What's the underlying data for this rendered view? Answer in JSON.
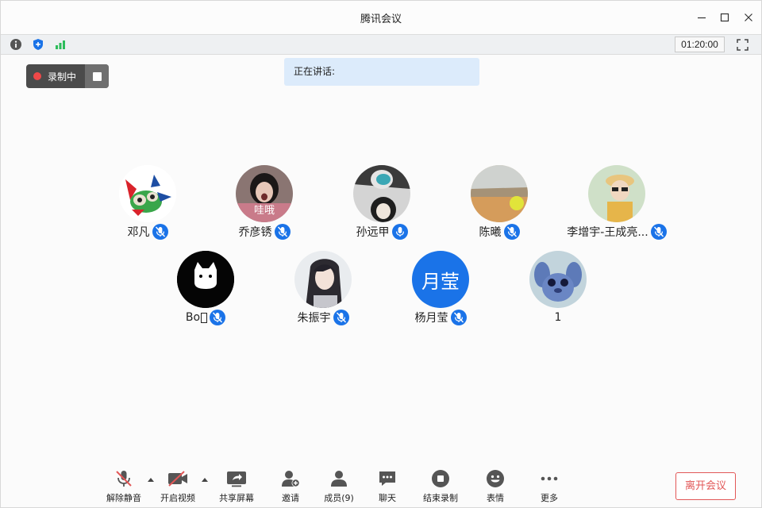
{
  "window": {
    "title": "腾讯会议"
  },
  "status": {
    "timer": "01:20:00",
    "info_icon": "info-icon",
    "security_icon": "shield-icon",
    "signal_icon": "signal-bars-icon"
  },
  "recording": {
    "label": "录制中"
  },
  "speaking": {
    "label": "正在讲话:"
  },
  "participants": [
    {
      "name": "邓凡",
      "avatar": "cartoon-character-avatar"
    },
    {
      "name": "乔彦锈",
      "avatar": "photo-avatar",
      "overlay": "哇哦"
    },
    {
      "name": "孙远甲",
      "avatar": "photo-avatar"
    },
    {
      "name": "陈曦",
      "avatar": "tennis-ball-photo-avatar"
    },
    {
      "name": "李增宇-王成亮...",
      "avatar": "photo-avatar"
    },
    {
      "name": "Bo",
      "avatar": "black-cat-logo-avatar"
    },
    {
      "name": "朱振宇",
      "avatar": "illustrated-portrait-avatar"
    },
    {
      "name": "杨月莹",
      "avatar": "text-avatar",
      "initials": "月莹"
    },
    {
      "name": "1",
      "avatar": "stitch-cartoon-avatar"
    }
  ],
  "toolbar": {
    "unmute": "解除静音",
    "video": "开启视频",
    "share": "共享屏幕",
    "invite": "邀请",
    "members": "成员(9)",
    "chat": "聊天",
    "end_record": "结束录制",
    "emoji": "表情",
    "more": "更多",
    "leave": "离开会议"
  },
  "colors": {
    "accent": "#1a73e8",
    "danger": "#e25757",
    "signal": "#2dbd5b",
    "record": "#f04848"
  }
}
